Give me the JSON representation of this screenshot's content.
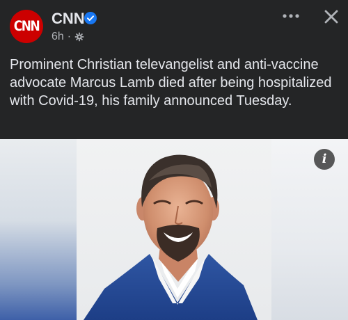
{
  "header": {
    "avatar_text": "CNN",
    "page_name": "CNN",
    "time": "6h",
    "separator": "·",
    "icons": {
      "verified": "verified-badge-icon",
      "audience": "gear-icon",
      "more": "more-dots-icon",
      "close": "close-icon"
    }
  },
  "post": {
    "caption": "Prominent Christian televangelist and anti-vaccine advocate Marcus Lamb died after being hospitalized with Covid-19, his family announced Tuesday."
  },
  "photo": {
    "info_icon": "info-icon",
    "info_glyph": "i"
  },
  "colors": {
    "background": "#242526",
    "text_primary": "#e4e6eb",
    "text_secondary": "#b0b3b8",
    "cnn_red": "#cc0000",
    "verified_blue": "#1877f2"
  }
}
